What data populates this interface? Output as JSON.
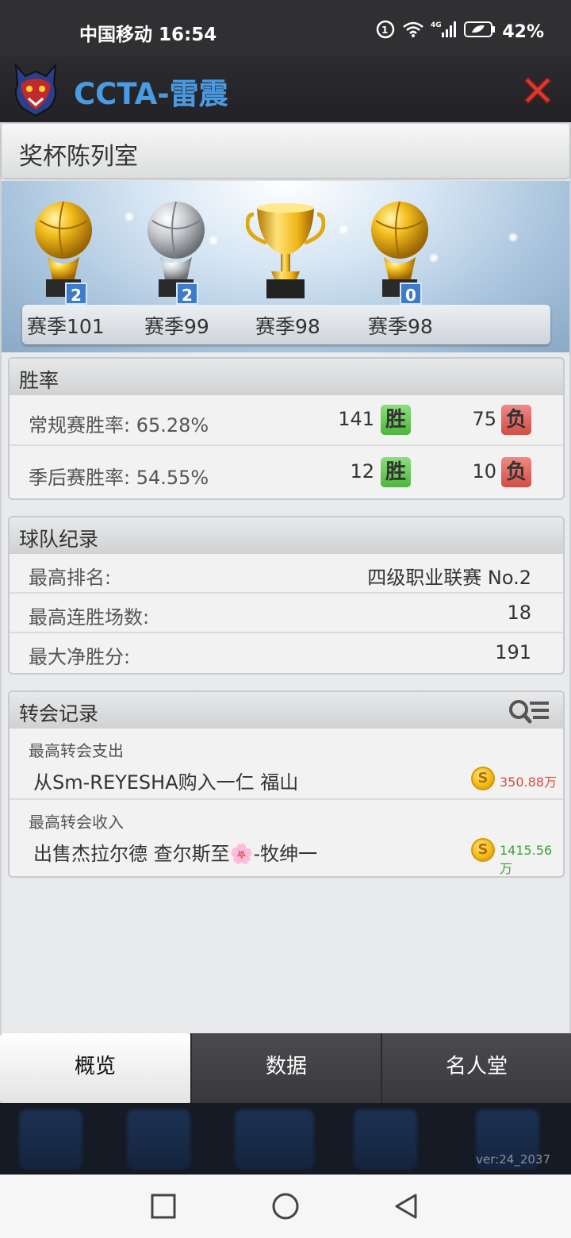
{
  "status_bar": {
    "carrier_time": "中国移动 16:54",
    "battery": "42%",
    "network": "4G"
  },
  "header": {
    "app_title": "CCTA-雷震",
    "accent": "#4a9be2",
    "close_color": "#d93a2e"
  },
  "panel": {
    "title": "奖杯陈列室"
  },
  "trophies": [
    {
      "icon": "gold-ball-trophy-icon",
      "count": "2",
      "season": "赛季101"
    },
    {
      "icon": "silver-ball-trophy-icon",
      "count": "2",
      "season": "赛季99"
    },
    {
      "icon": "gold-cup-trophy-icon",
      "count": "",
      "season": "赛季98"
    },
    {
      "icon": "gold-ball-trophy-icon",
      "count": "0",
      "season": "赛季98"
    }
  ],
  "win_rate": {
    "title": "胜率",
    "regular": {
      "label": "常规赛胜率:  65.28%",
      "wins": "141",
      "win_tag": "胜",
      "losses": "75",
      "loss_tag": "负"
    },
    "playoff": {
      "label": "季后赛胜率:  54.55%",
      "wins": "12",
      "win_tag": "胜",
      "losses": "10",
      "loss_tag": "负"
    }
  },
  "team_record": {
    "title": "球队纪录",
    "rows": [
      {
        "label": "最高排名:",
        "value": "四级职业联赛 No.2"
      },
      {
        "label": "最高连胜场数:",
        "value": "18"
      },
      {
        "label": "最大净胜分:",
        "value": "191"
      }
    ]
  },
  "transfer": {
    "title": "转会记录",
    "spend": {
      "label": "最高转会支出",
      "desc": "从Sm-REYESHA购入一仁 福山",
      "amount": "350.88万",
      "amount_color": "#e04a3c"
    },
    "income": {
      "label": "最高转会收入",
      "desc": "出售杰拉尔德 查尔斯至🌸-牧绅一",
      "amount": "1415.56万",
      "amount_color": "#3aa534"
    },
    "coin_glyph": "S"
  },
  "tabs": [
    {
      "label": "概览",
      "active": true
    },
    {
      "label": "数据",
      "active": false
    },
    {
      "label": "名人堂",
      "active": false
    }
  ],
  "version": "ver:24_2037"
}
